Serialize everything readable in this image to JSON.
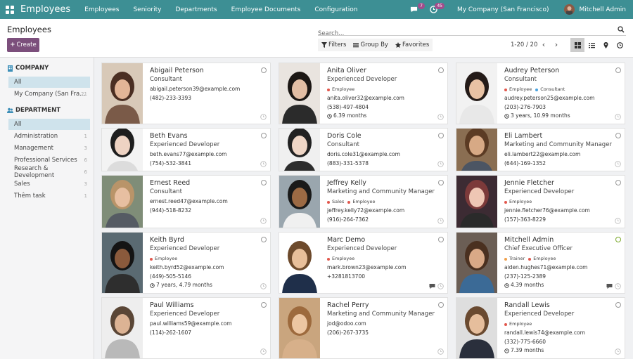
{
  "app": {
    "title": "Employees",
    "menu": [
      "Employees",
      "Seniority",
      "Departments",
      "Employee Documents",
      "Configuration"
    ],
    "chat_badge": "7",
    "activity_badge": "45",
    "company": "My Company (San Francisco)",
    "user": "Mitchell Admin"
  },
  "control": {
    "page_title": "Employees",
    "create_label": "Create",
    "search_placeholder": "Search...",
    "filters_label": "Filters",
    "groupby_label": "Group By",
    "favorites_label": "Favorites",
    "pager": "1-20 / 20"
  },
  "sidebar": {
    "company_title": "COMPANY",
    "company_items": [
      {
        "label": "All",
        "count": ""
      },
      {
        "label": "My Company (San Fra...",
        "count": "21"
      }
    ],
    "department_title": "DEPARTMENT",
    "department_items": [
      {
        "label": "All",
        "count": ""
      },
      {
        "label": "Administration",
        "count": "1"
      },
      {
        "label": "Management",
        "count": "3"
      },
      {
        "label": "Professional Services",
        "count": "6"
      },
      {
        "label": "Research & Development",
        "count": "6"
      },
      {
        "label": "Sales",
        "count": "3"
      },
      {
        "label": "Thêm task",
        "count": "1"
      }
    ]
  },
  "colors": {
    "topbar": "#3d8f94",
    "create": "#7c4f7c",
    "tag_employee": "#e2574c",
    "tag_consultant": "#4aa3df",
    "tag_sales": "#e2574c",
    "tag_trainer": "#f0a04b"
  },
  "employees": [
    {
      "name": "Abigail Peterson",
      "job": "Consultant",
      "tags": [],
      "email": "abigail.peterson39@example.com",
      "phone": "(482)-233-3393",
      "seniority": ""
    },
    {
      "name": "Anita Oliver",
      "job": "Experienced Developer",
      "tags": [
        "Employee"
      ],
      "email": "anita.oliver32@example.com",
      "phone": "(538)-497-4804",
      "seniority": "6.39 months"
    },
    {
      "name": "Audrey Peterson",
      "job": "Consultant",
      "tags": [
        "Employee",
        "Consultant"
      ],
      "email": "audrey.peterson25@example.com",
      "phone": "(203)-276-7903",
      "seniority": "3 years, 10.99 months"
    },
    {
      "name": "Beth Evans",
      "job": "Experienced Developer",
      "tags": [],
      "email": "beth.evans77@example.com",
      "phone": "(754)-532-3841",
      "seniority": ""
    },
    {
      "name": "Doris Cole",
      "job": "Consultant",
      "tags": [],
      "email": "doris.cole31@example.com",
      "phone": "(883)-331-5378",
      "seniority": ""
    },
    {
      "name": "Eli Lambert",
      "job": "Marketing and Community Manager",
      "tags": [],
      "email": "eli.lambert22@example.com",
      "phone": "(644)-169-1352",
      "seniority": ""
    },
    {
      "name": "Ernest Reed",
      "job": "Consultant",
      "tags": [],
      "email": "ernest.reed47@example.com",
      "phone": "(944)-518-8232",
      "seniority": ""
    },
    {
      "name": "Jeffrey Kelly",
      "job": "Marketing and Community Manager",
      "tags": [
        "Sales",
        "Employee"
      ],
      "email": "jeffrey.kelly72@example.com",
      "phone": "(916)-264-7362",
      "seniority": ""
    },
    {
      "name": "Jennie Fletcher",
      "job": "Experienced Developer",
      "tags": [
        "Employee"
      ],
      "email": "jennie.fletcher76@example.com",
      "phone": "(157)-363-8229",
      "seniority": ""
    },
    {
      "name": "Keith Byrd",
      "job": "Experienced Developer",
      "tags": [
        "Employee"
      ],
      "email": "keith.byrd52@example.com",
      "phone": "(449)-505-5146",
      "seniority": "7 years, 4.79 months"
    },
    {
      "name": "Marc Demo",
      "job": "Experienced Developer",
      "tags": [
        "Employee"
      ],
      "email": "mark.brown23@example.com",
      "phone": "+3281813700",
      "seniority": ""
    },
    {
      "name": "Mitchell Admin",
      "job": "Chief Executive Officer",
      "tags": [
        "Trainer",
        "Employee"
      ],
      "email": "aiden.hughes71@example.com",
      "phone": "(237)-125-2389",
      "seniority": "4.39 months"
    },
    {
      "name": "Paul Williams",
      "job": "Experienced Developer",
      "tags": [],
      "email": "paul.williams59@example.com",
      "phone": "(114)-262-1607",
      "seniority": ""
    },
    {
      "name": "Rachel Perry",
      "job": "Marketing and Community Manager",
      "tags": [],
      "email": "jod@odoo.com",
      "phone": "(206)-267-3735",
      "seniority": ""
    },
    {
      "name": "Randall Lewis",
      "job": "Experienced Developer",
      "tags": [
        "Employee"
      ],
      "email": "randall.lewis74@example.com",
      "phone": "(332)-775-6660",
      "seniority": "7.39 months"
    }
  ]
}
